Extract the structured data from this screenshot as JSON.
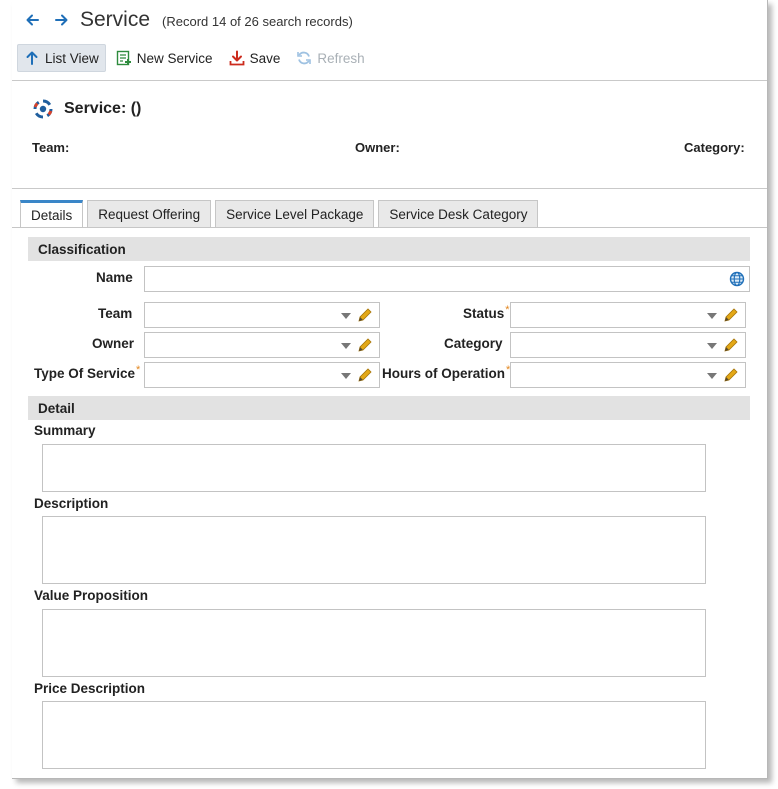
{
  "titlebar": {
    "title": "Service",
    "record_info": "(Record 14 of 26 search records)"
  },
  "toolbar": {
    "list_view": "List View",
    "new_service": "New Service",
    "save": "Save",
    "refresh": "Refresh"
  },
  "header": {
    "title": "Service: ()",
    "team_label": "Team:",
    "owner_label": "Owner:",
    "category_label": "Category:"
  },
  "tabs": [
    {
      "label": "Details"
    },
    {
      "label": "Request Offering"
    },
    {
      "label": "Service Level Package"
    },
    {
      "label": "Service Desk Category"
    }
  ],
  "classification": {
    "title": "Classification",
    "name_label": "Name",
    "name_value": "",
    "team_label": "Team",
    "owner_label": "Owner",
    "type_label": "Type Of Service",
    "status_label": "Status",
    "category_label": "Category",
    "hours_label": "Hours of Operation"
  },
  "detail": {
    "title": "Detail",
    "summary_label": "Summary",
    "description_label": "Description",
    "value_label": "Value Proposition",
    "price_label": "Price Description"
  },
  "colors": {
    "accent": "#3a86c8",
    "required": "#e2861e",
    "pencil": "#e3a817",
    "save_icon": "#cc2b1d",
    "new_icon": "#2e8b3d"
  }
}
